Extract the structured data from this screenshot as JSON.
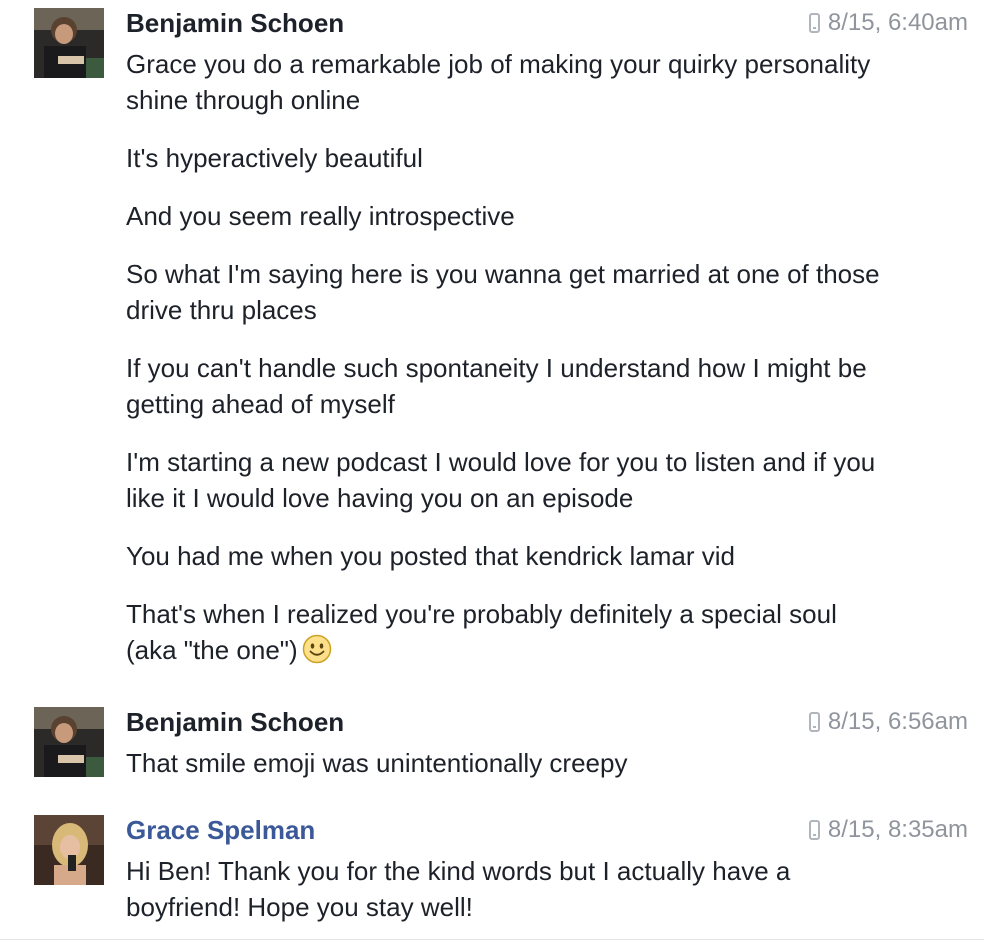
{
  "groups": [
    {
      "sender": "Benjamin Schoen",
      "timestamp": "8/15, 6:40am",
      "avatar_icon": "profile-photo",
      "messages": [
        "Grace you do a remarkable job of making your quirky personality shine through online",
        "It's hyperactively beautiful",
        "And you seem really introspective",
        "So what I'm saying here is you wanna get married at one of those drive thru places",
        "If you can't handle such spontaneity I understand how I might be getting ahead of myself",
        "I'm starting a new podcast I would love for you to listen and if you like it I would love having you on an episode",
        "You had me when you posted that kendrick lamar vid",
        "That's when I realized you're probably definitely a special soul (aka \"the one\")"
      ],
      "emoji": "smile-emoji"
    },
    {
      "sender": "Benjamin Schoen",
      "timestamp": "8/15, 6:56am",
      "avatar_icon": "profile-photo",
      "messages": [
        "That smile emoji was unintentionally creepy"
      ]
    },
    {
      "sender": "Grace Spelman",
      "timestamp": "8/15, 8:35am",
      "avatar_icon": "profile-photo",
      "messages": [
        "Hi Ben! Thank you for the kind words but I actually have a boyfriend! Hope you stay well!"
      ]
    }
  ],
  "colors": {
    "sender_default": "#1d2129",
    "sender_grace": "#3b5998",
    "timestamp": "#90949c",
    "text": "#1d2129"
  }
}
